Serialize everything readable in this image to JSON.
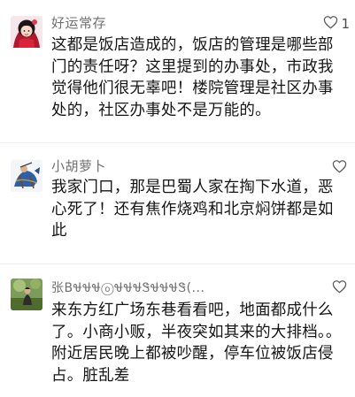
{
  "comments": [
    {
      "username": "好运常存",
      "like_count": "1",
      "text": "这都是饭店造成的，饭店的管理是哪些部门的责任呀？这里提到的办事处，市政我觉得他们很无辜吧！楼院管理是社区办事处的，社区办事处不是万能的。"
    },
    {
      "username": "小胡萝卜",
      "like_count": "",
      "text": "我家门口，那是巴蜀人家在掏下水道，恶心死了！还有焦作烧鸡和北京焖饼都是如此"
    },
    {
      "username": "张BᏠᏠᏠⓞᏠᏠᏠᏕᏠᏠᏠᏕ(...",
      "like_count": "",
      "text": "来东方红广场东巷看看吧，地面都成什么了。小商小贩，半夜突如其来的大排档。。附近居民晚上都被吵醒，停车位被饭店侵占。脏乱差"
    }
  ],
  "icons": {
    "like": "heart-outline-icon"
  },
  "colors": {
    "username": "#707070",
    "text": "#151515",
    "icon": "#5c5c5c"
  }
}
